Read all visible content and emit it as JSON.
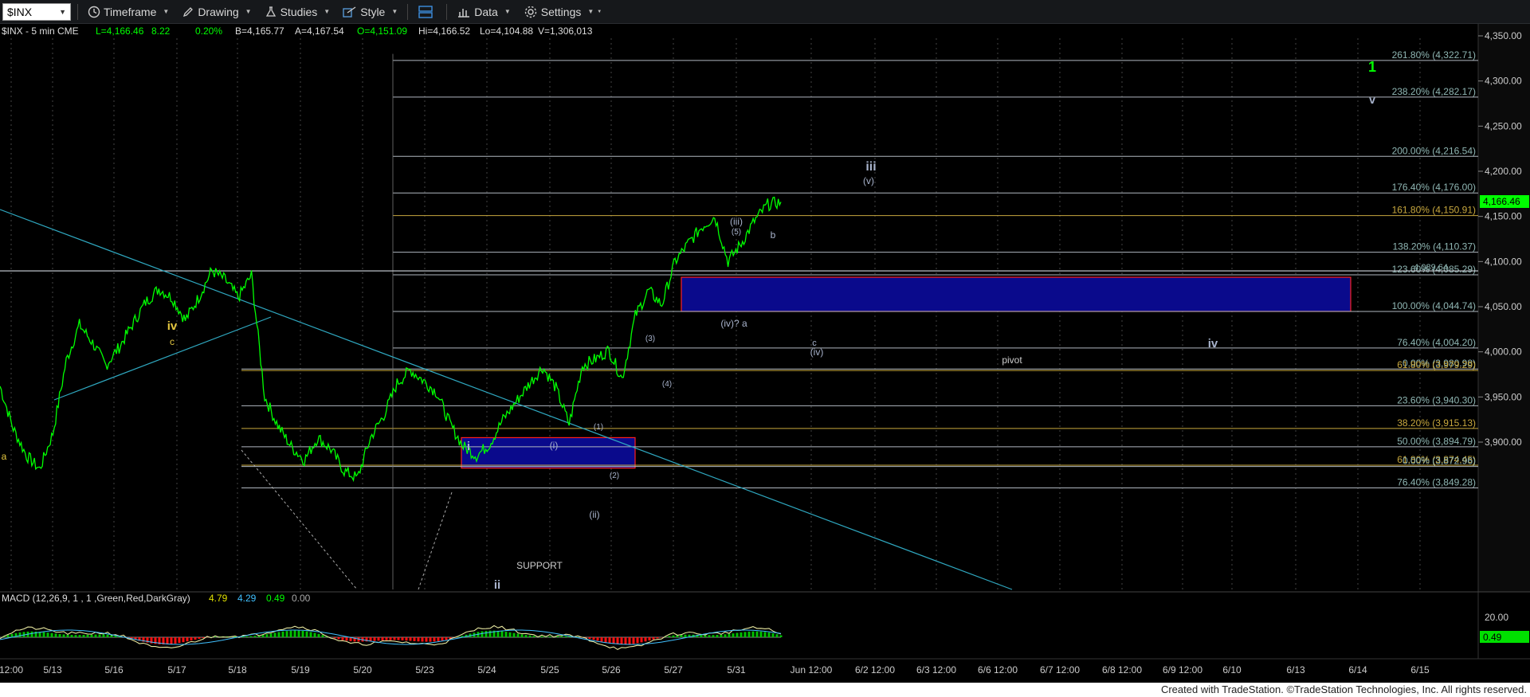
{
  "toolbar": {
    "symbol": "$INX",
    "items": [
      {
        "label": "Timeframe",
        "icon": "clock-icon"
      },
      {
        "label": "Drawing",
        "icon": "pencil-icon"
      },
      {
        "label": "Studies",
        "icon": "flask-icon"
      },
      {
        "label": "Style",
        "icon": "style-icon"
      },
      {
        "label": "",
        "icon": "panes-icon"
      },
      {
        "label": "Data",
        "icon": "bar-chart-icon"
      },
      {
        "label": "Settings",
        "icon": "gear-icon"
      }
    ]
  },
  "header": {
    "symbol_line": "$INX - 5 min  CME",
    "last": "L=4,166.46",
    "change": "8.22",
    "pct": "0.20%",
    "bid": "B=4,165.77",
    "ask": "A=4,167.54",
    "open": "O=4,151.09",
    "high": "Hi=4,166.52",
    "low": "Lo=4,104.88",
    "volume": "V=1,306,013"
  },
  "macd_header": {
    "label": "MACD (12,26,9, 1 , 1 ,Green,Red,DarkGray)",
    "v1": "4.79",
    "v2": "4.29",
    "v3": "0.49",
    "v4": "0.00"
  },
  "footer_text": "Created with TradeStation. ©TradeStation Technologies, Inc. All rights reserved.",
  "colors": {
    "price": "#00ff00",
    "fib_line": "#b0b7c0",
    "fib_label": "#8fb6b3",
    "gold": "#c8a83e",
    "wave_label": "#a8b3cc",
    "box_fill": "#0a0a8c",
    "box_border": "#ff2020",
    "trendline": "#2fa8c0"
  },
  "chart_data": [
    {
      "type": "line",
      "title": "$INX - 5 min",
      "y_axis": {
        "range": [
          3840,
          4360
        ],
        "ticks": [
          "4,350.00",
          "4,300.00",
          "4,250.00",
          "4,200.00",
          "4,150.00",
          "4,100.00",
          "4,050.00",
          "4,000.00",
          "3,950.00",
          "3,900.00"
        ]
      },
      "x_axis": {
        "ticks": [
          "12:00",
          "5/13",
          "5/16",
          "5/17",
          "5/18",
          "5/19",
          "5/20",
          "5/23",
          "5/24",
          "5/25",
          "5/26",
          "5/27",
          "5/31",
          "Jun 12:00",
          "6/2 12:00",
          "6/3 12:00",
          "6/6 12:00",
          "6/7 12:00",
          "6/8 12:00",
          "6/9 12:00",
          "6/10",
          "6/13",
          "6/14",
          "6/15"
        ]
      },
      "last_price_label": "4,166.46",
      "series": [
        {
          "values": [
            3962,
            3915,
            3885,
            3870,
            3910,
            3990,
            4030,
            4010,
            3985,
            4005,
            4030,
            4055,
            4070,
            4060,
            4035,
            4060,
            4090,
            4080,
            4060,
            4085,
            3950,
            3918,
            3895,
            3880,
            3905,
            3892,
            3868,
            3860,
            3905,
            3930,
            3965,
            3980,
            3968,
            3955,
            3920,
            3895,
            3885,
            3898,
            3925,
            3945,
            3965,
            3983,
            3960,
            3920,
            3985,
            3992,
            4002,
            3970,
            4040,
            4068,
            4052,
            4100,
            4120,
            4138,
            4150,
            4100,
            4120,
            4145,
            4163,
            4166
          ]
        }
      ],
      "fib_levels": [
        {
          "label": "261.80% (4,322.71)",
          "value": 4322.71
        },
        {
          "label": "238.20% (4,282.17)",
          "value": 4282.17
        },
        {
          "label": "200.00% (4,216.54)",
          "value": 4216.54
        },
        {
          "label": "176.40% (4,176.00)",
          "value": 4176.0
        },
        {
          "label": "161.80% (4,150.91)",
          "value": 4150.91
        },
        {
          "label": "138.20% (4,110.37)",
          "value": 4110.37
        },
        {
          "label": "123.60% (4,085.29)",
          "value": 4085.29
        },
        {
          "label": "100.00% (4,044.74)",
          "value": 4044.74
        },
        {
          "label": "76.40% (4,004.20)",
          "value": 4004.2
        },
        {
          "label": "0.00% (3,980.98)",
          "value": 3980.98
        },
        {
          "label": "61.80% (3,979.29)",
          "value": 3979.29
        },
        {
          "label": "23.60% (3,940.30)",
          "value": 3940.3
        },
        {
          "label": "38.20% (3,915.13)",
          "value": 3915.13
        },
        {
          "label": "50.00% (3,894.79)",
          "value": 3894.79
        },
        {
          "label": "61.80% (3,874.45)",
          "value": 3874.45
        },
        {
          "label": "0.00% (3,872.96)",
          "value": 3872.96
        },
        {
          "label": "76.40% (3,849.28)",
          "value": 3849.28
        }
      ],
      "annotations": {
        "pivot_label": "pivot",
        "pivot_range": [
          4044.74,
          4089.64
        ],
        "pivot_top_value": "4,089.64",
        "support_label": "SUPPORT",
        "support_range": [
          3872.96,
          3912.0
        ],
        "wave_labels": [
          "1",
          "v",
          "iii",
          "(v)",
          "(iii)",
          "(5)",
          "b",
          "(iv)? a",
          "c",
          "(iv)",
          "iv",
          "(3)",
          "(4)",
          "(1)",
          "(2)",
          "(ii)",
          "(i)",
          "i",
          "ii",
          "iv",
          "c",
          "a"
        ]
      }
    },
    {
      "type": "line",
      "title": "MACD (12,26,9, 1 , 1 ,Green,Red,DarkGray)",
      "y_axis": {
        "ticks": [
          "20.00",
          "0.49"
        ]
      },
      "values": {
        "macd": 4.79,
        "signal": 4.29,
        "histogram": 0.49,
        "zero": 0.0
      }
    }
  ]
}
